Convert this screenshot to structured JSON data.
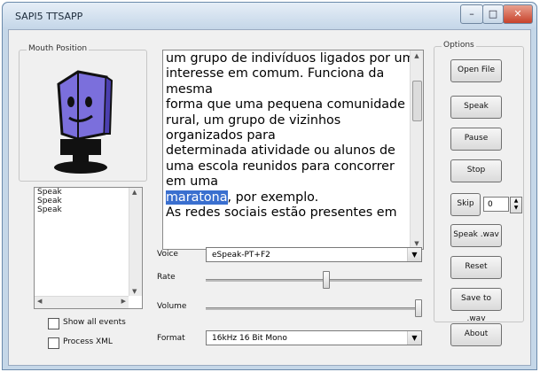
{
  "window": {
    "title": "SAPI5 TTSAPP",
    "controls": {
      "minimize": "–",
      "maximize": "□",
      "close": "✕"
    }
  },
  "mouth_group": {
    "label": "Mouth Position"
  },
  "events_list": {
    "items": [
      "Speak",
      "Speak",
      "Speak"
    ]
  },
  "text_area": {
    "lines": [
      "um grupo de indivíduos ligados por um",
      "interesse em comum. Funciona da",
      "mesma",
      "forma que uma pequena comunidade",
      "rural, um grupo de vizinhos",
      "organizados para",
      "determinada atividade ou alunos de",
      "uma escola reunidos para concorrer",
      "em uma"
    ],
    "highlight_word": "maratona",
    "after_highlight": ", por exemplo.",
    "cut_line": "As redes sociais estão presentes em"
  },
  "options": {
    "label": "Options",
    "open_file": "Open File",
    "speak": "Speak",
    "pause": "Pause",
    "stop": "Stop",
    "skip": "Skip",
    "skip_value": "0",
    "speak_wav": "Speak .wav",
    "reset": "Reset",
    "save_to_wav": "Save to .wav",
    "about": "About"
  },
  "voice": {
    "label": "Voice",
    "value": "eSpeak-PT+F2"
  },
  "rate": {
    "label": "Rate",
    "level": 0.56
  },
  "volume": {
    "label": "Volume",
    "level": 1.0
  },
  "format": {
    "label": "Format",
    "value": "16kHz 16 Bit Mono"
  },
  "checkboxes": {
    "show_all_events": "Show all events",
    "process_xml": "Process XML"
  },
  "colors": {
    "highlight": "#3a6fcf",
    "robot_head": "#7b6fdc",
    "robot_body": "#111111"
  }
}
